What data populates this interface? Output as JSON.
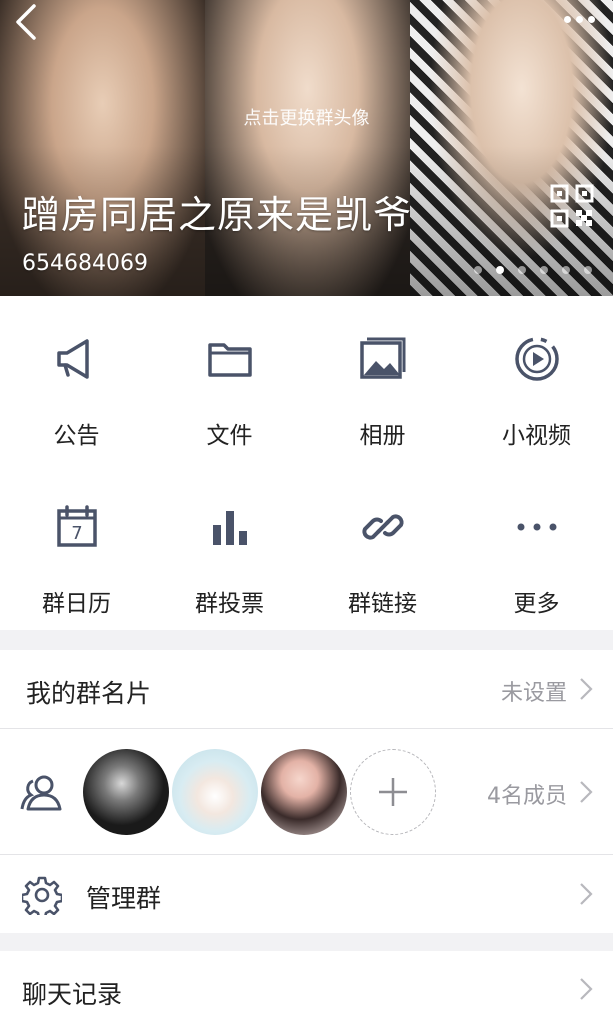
{
  "header": {
    "change_avatar": "点击更换群头像",
    "group_name": "蹭房同居之原来是凯爷",
    "group_id": "654684069",
    "carousel_total": 6,
    "carousel_active": 2
  },
  "features": [
    {
      "label": "公告",
      "icon": "megaphone-icon"
    },
    {
      "label": "文件",
      "icon": "folder-icon"
    },
    {
      "label": "相册",
      "icon": "photo-album-icon"
    },
    {
      "label": "小视频",
      "icon": "video-icon"
    },
    {
      "label": "群日历",
      "icon": "calendar-icon"
    },
    {
      "label": "群投票",
      "icon": "bar-chart-icon"
    },
    {
      "label": "群链接",
      "icon": "link-icon"
    },
    {
      "label": "更多",
      "icon": "more-dots-icon"
    }
  ],
  "calendar_day": "7",
  "card": {
    "title": "我的群名片",
    "value": "未设置"
  },
  "members": {
    "count_label": "4名成员"
  },
  "manage": {
    "title": "管理群"
  },
  "chat_history": {
    "title": "聊天记录"
  },
  "colors": {
    "icon": "#4a5369",
    "accent_text": "#9a9aa0"
  }
}
